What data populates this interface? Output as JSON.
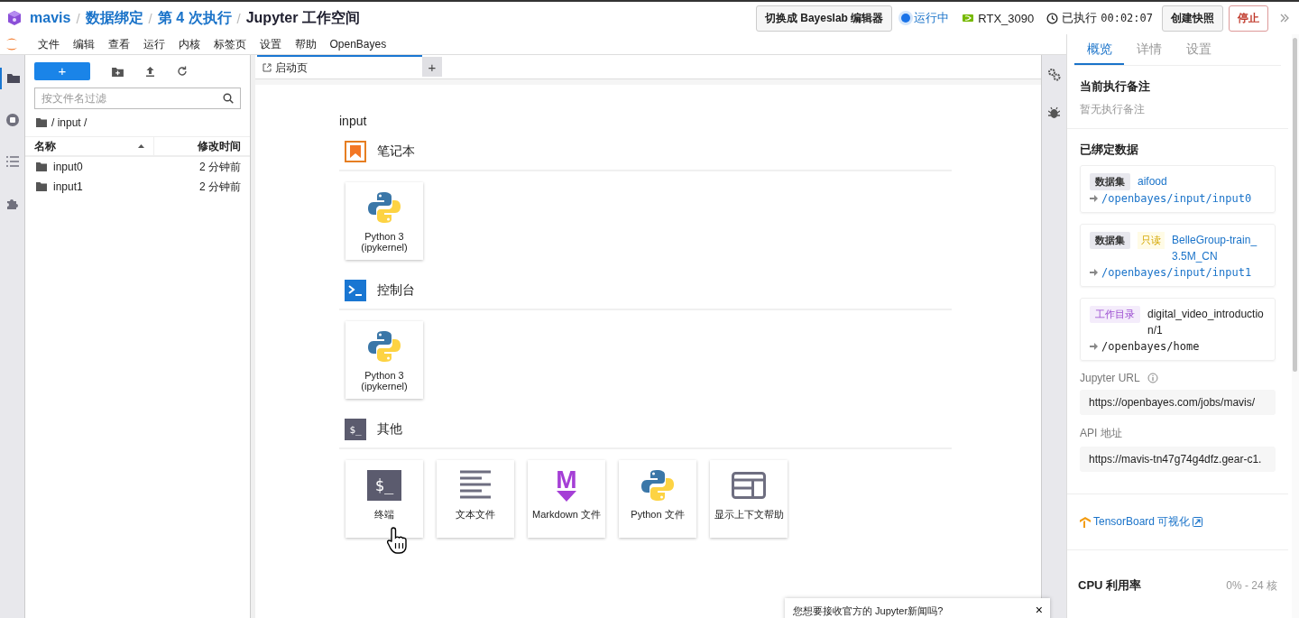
{
  "breadcrumb_separator": "/",
  "breadcrumb": [
    {
      "text": "mavis",
      "kind": "link"
    },
    {
      "text": "数据绑定",
      "kind": "link"
    },
    {
      "text": "第 4 次执行",
      "kind": "link"
    },
    {
      "text": "Jupyter 工作空间",
      "kind": "current"
    }
  ],
  "top_actions": {
    "switch_button": "切换成 Bayeslab 编辑器",
    "status": {
      "label": "运行中",
      "running": true
    },
    "gpu": "RTX_3090",
    "elapsed": {
      "label": "已执行",
      "time": "00:02:07"
    },
    "snapshot_button": "创建快照",
    "stop_button": "停止"
  },
  "menu": [
    "文件",
    "编辑",
    "查看",
    "运行",
    "内核",
    "标签页",
    "设置",
    "帮助",
    "OpenBayes"
  ],
  "side_tools": [
    {
      "kind": "folder",
      "selected": true
    },
    {
      "kind": "running",
      "selected": false
    },
    {
      "kind": "toc",
      "selected": false
    },
    {
      "kind": "extensions",
      "selected": false
    }
  ],
  "file_browser": {
    "new_button": "+",
    "filter": {
      "placeholder": "按文件名过滤"
    },
    "path": "/ input /",
    "columns": [
      "名称",
      "修改时间"
    ],
    "files": [
      {
        "name": "input0",
        "modified": "2 分钟前"
      },
      {
        "name": "input1",
        "modified": "2 分钟前"
      }
    ]
  },
  "tabs": [
    {
      "label": "启动页",
      "selected": true
    }
  ],
  "add_tab": "+",
  "launcher": {
    "title": "input",
    "sections": [
      {
        "title": "笔记本",
        "kind": "notebook",
        "items": [
          {
            "label": "Python 3 (ipykernel)",
            "kind": "python"
          }
        ]
      },
      {
        "title": "控制台",
        "kind": "console",
        "items": [
          {
            "label": "Python 3 (ipykernel)",
            "kind": "python"
          }
        ]
      },
      {
        "title": "其他",
        "kind": "other",
        "glyph": "$_",
        "items": [
          {
            "label": "终端",
            "kind": "terminal",
            "glyph": "$_"
          },
          {
            "label": "文本文件",
            "kind": "text"
          },
          {
            "label": "Markdown 文件",
            "kind": "markdown",
            "glyph": "M"
          },
          {
            "label": "Python 文件",
            "kind": "python"
          },
          {
            "label": "显示上下文帮助",
            "kind": "help"
          }
        ]
      }
    ]
  },
  "notification": {
    "text": "您想要接收官方的 Jupyter新闻吗?",
    "close": "×"
  },
  "panel": {
    "tabs": [
      {
        "label": "概览",
        "selected": true
      },
      {
        "label": "详情",
        "selected": false
      },
      {
        "label": "设置",
        "selected": false
      }
    ],
    "note": {
      "title": "当前执行备注",
      "text": "暂无执行备注"
    },
    "bound": {
      "title": "已绑定数据",
      "items": [
        {
          "tag": "数据集",
          "kind": "dataset",
          "name": "aifood",
          "path": "/openbayes/input/input0"
        },
        {
          "tag": "数据集",
          "kind": "dataset",
          "badges": [
            "只读"
          ],
          "name": "BelleGroup-train_3.5M_CN",
          "path": "/openbayes/input/input1"
        },
        {
          "tag": "工作目录",
          "kind": "workdir",
          "name": "digital_video_introduction/1",
          "path": "/openbayes/home"
        }
      ]
    },
    "jupyter_url": {
      "label": "Jupyter URL",
      "value": "https://openbayes.com/jobs/mavis/"
    },
    "api": {
      "label": "API 地址",
      "value": "https://mavis-tn47g74g4dfz.gear-c1."
    },
    "tensorboard": "TensorBoard 可视化",
    "cpu": {
      "label": "CPU 利用率",
      "value": "0% - 24 核"
    }
  }
}
